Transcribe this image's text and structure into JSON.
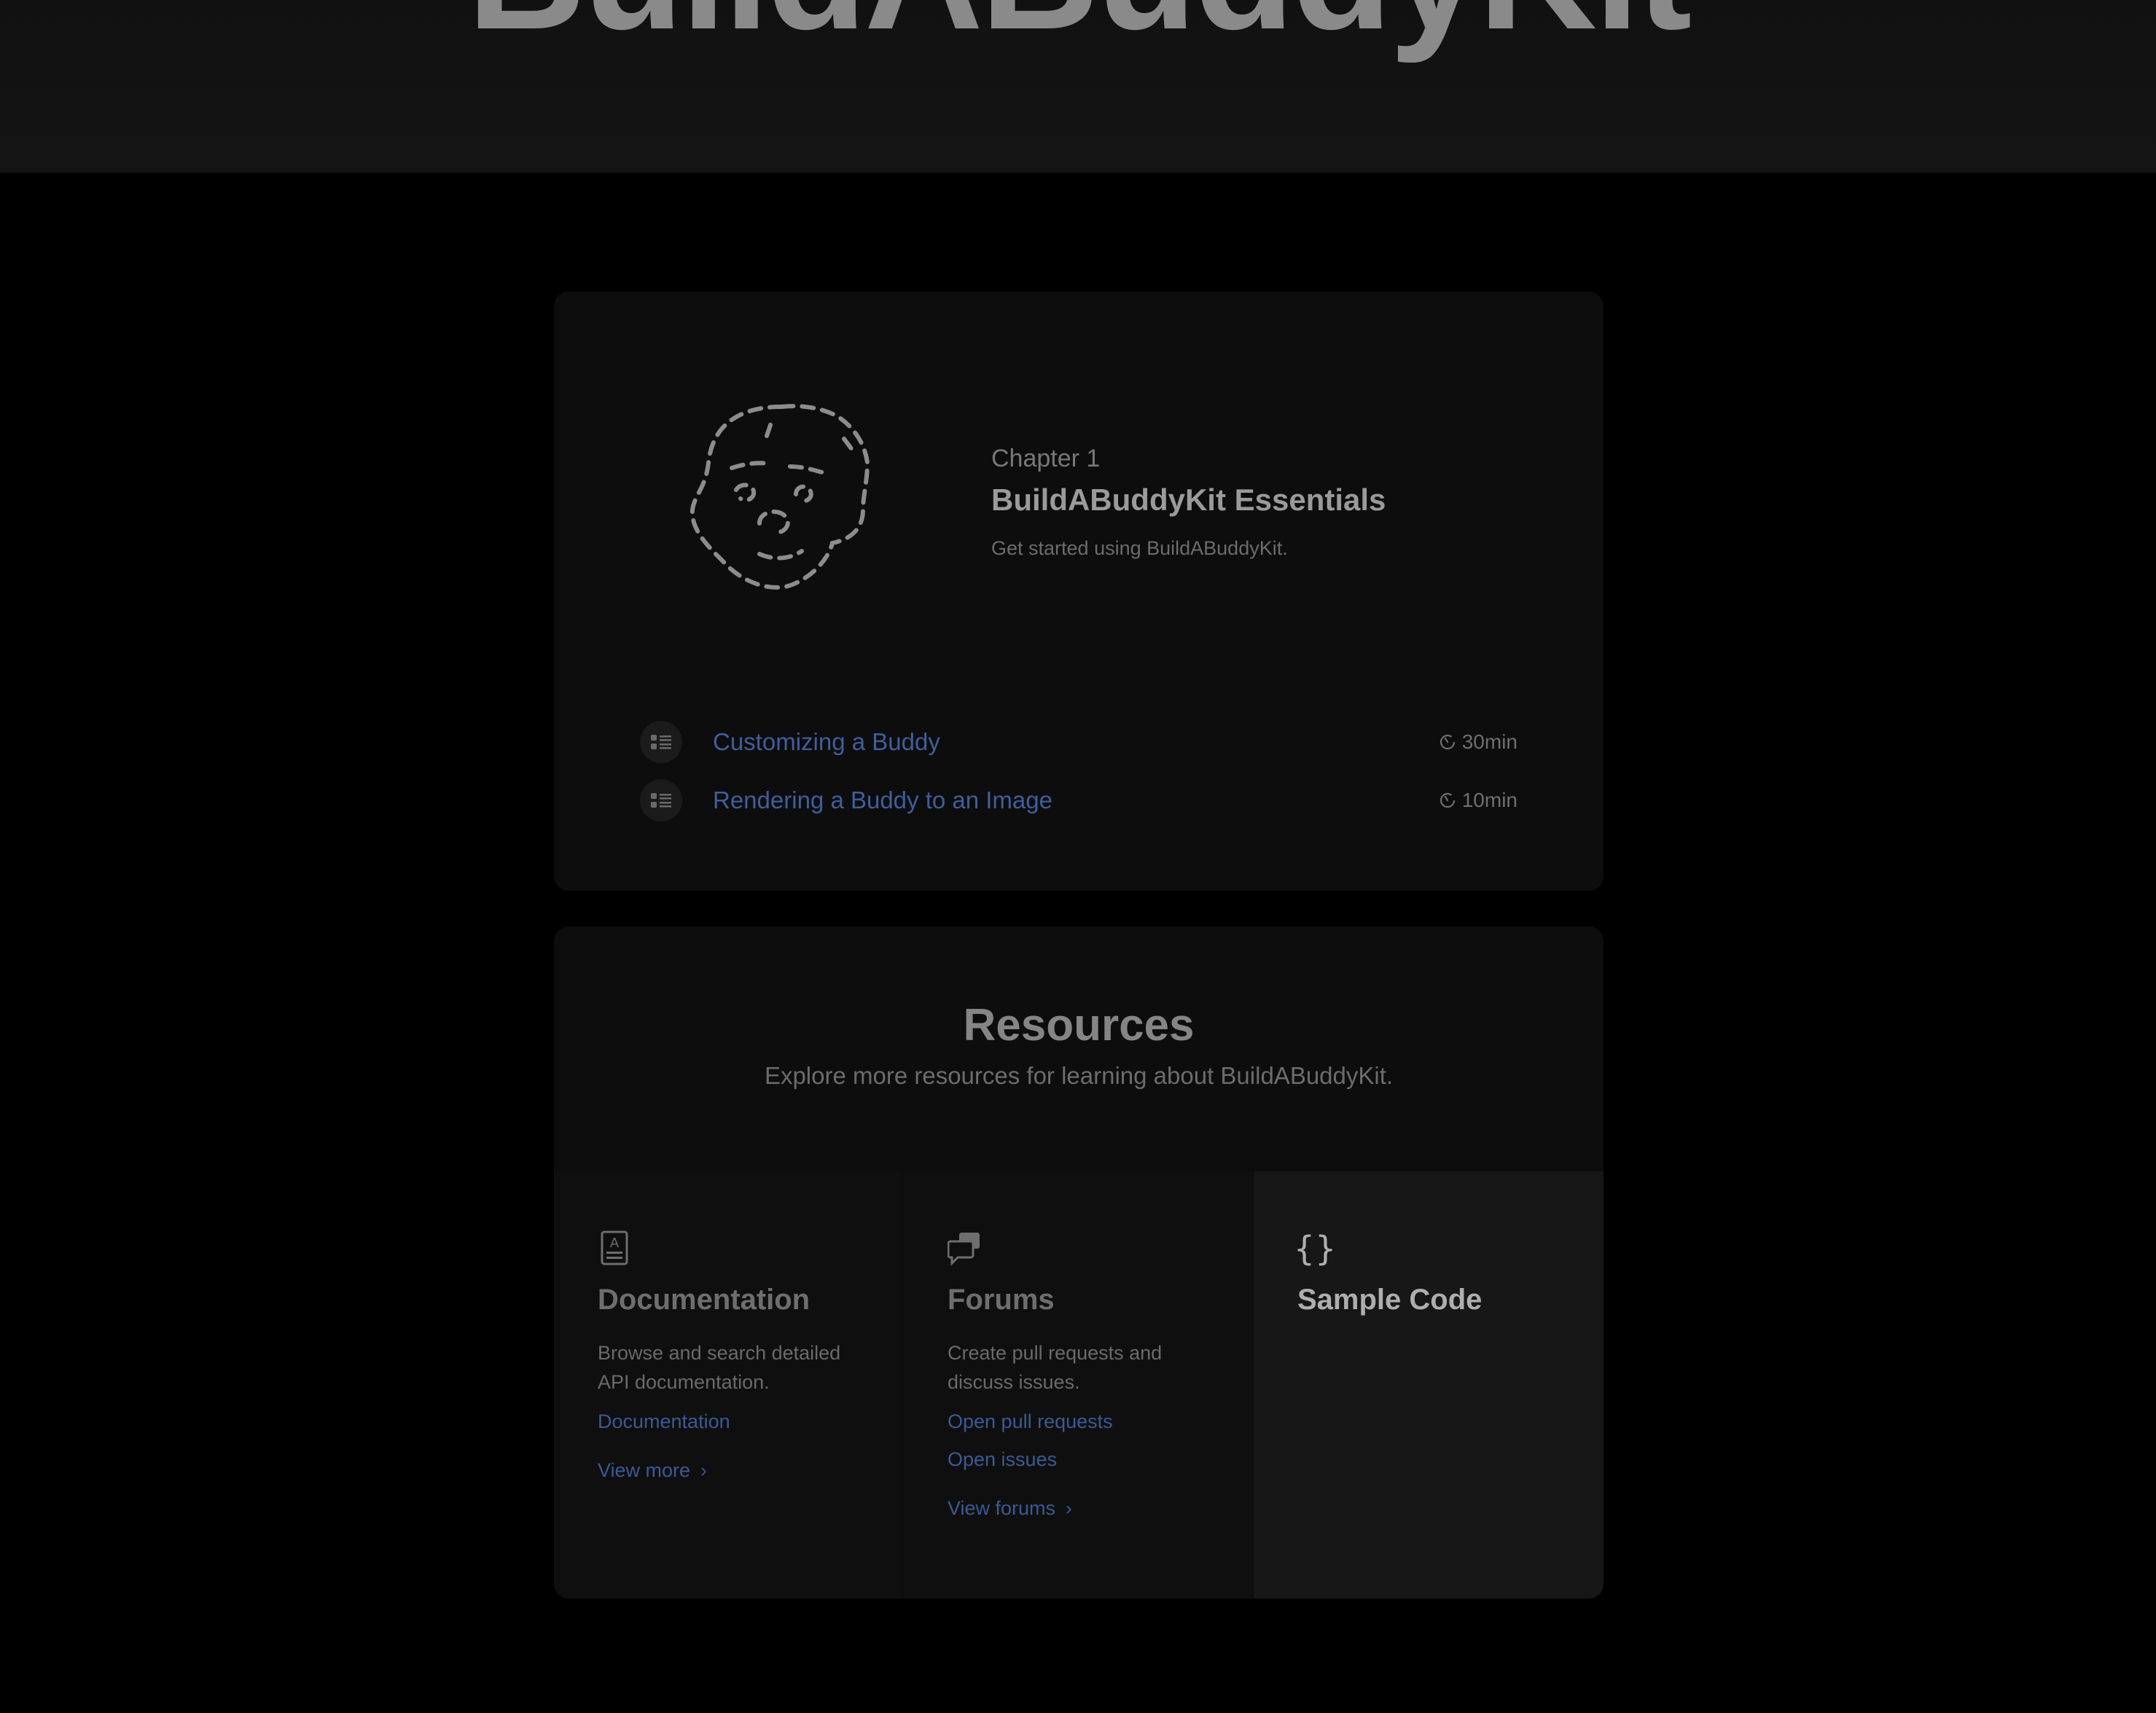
{
  "hero": {
    "title": "BuildABuddyKit"
  },
  "chapter": {
    "label": "Chapter 1",
    "title": "BuildABuddyKit Essentials",
    "description": "Get started using BuildABuddyKit.",
    "tutorials": [
      {
        "title": "Customizing a Buddy",
        "duration": "30min",
        "icon": "list-icon"
      },
      {
        "title": "Rendering a Buddy to an Image",
        "duration": "10min",
        "icon": "list-icon"
      }
    ]
  },
  "resources": {
    "title": "Resources",
    "subtitle": "Explore more resources for learning about BuildABuddyKit.",
    "items": [
      {
        "icon": "documentation-icon",
        "title": "Documentation",
        "description": "Browse and search detailed API documentation.",
        "links": [
          "Documentation"
        ],
        "more": "View more"
      },
      {
        "icon": "forums-icon",
        "title": "Forums",
        "description": "Create pull requests and discuss issues.",
        "links": [
          "Open pull requests",
          "Open issues"
        ],
        "more": "View forums"
      },
      {
        "icon": "curly-braces-icon",
        "title": "Sample Code"
      }
    ]
  },
  "colors": {
    "background": "#000000",
    "card": "#0d0d0d",
    "link": "#3e5f9c",
    "heading": "#9a9a9a"
  }
}
